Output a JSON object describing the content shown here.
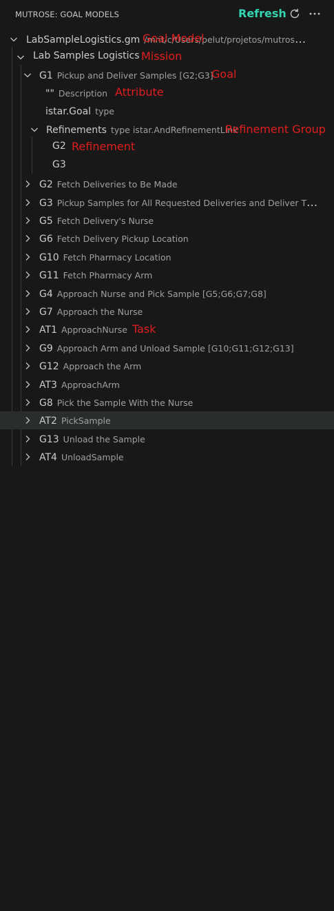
{
  "header": {
    "title": "MUTROSE: GOAL MODELS",
    "refresh_annotation": "Refresh",
    "refresh_icon": "refresh-icon",
    "more_icon": "ellipsis-icon"
  },
  "tree": {
    "root": {
      "label": "LabSampleLogistics.gm",
      "description": "/mnt/c/Users/pelut/projetos/mutrose-vs..."
    },
    "mission": {
      "label": "Lab Samples Logistics"
    },
    "g1": {
      "label": "G1",
      "description": "Pickup and Deliver Samples [G2;G3]"
    },
    "attribute": {
      "label": "\"\"",
      "description": "Description"
    },
    "type": {
      "label": "istar.Goal",
      "description": "type"
    },
    "refinements": {
      "label": "Refinements",
      "description": "type istar.AndRefinementLink"
    },
    "ref_g2": {
      "label": "G2"
    },
    "ref_g3": {
      "label": "G3"
    },
    "items": [
      {
        "label": "G2",
        "description": "Fetch Deliveries to Be Made"
      },
      {
        "label": "G3",
        "description": "Pickup Samples for All Requested Deliveries and Deliver The..."
      },
      {
        "label": "G5",
        "description": "Fetch Delivery's Nurse"
      },
      {
        "label": "G6",
        "description": "Fetch Delivery Pickup Location"
      },
      {
        "label": "G10",
        "description": "Fetch Pharmacy Location"
      },
      {
        "label": "G11",
        "description": "Fetch Pharmacy Arm"
      },
      {
        "label": "G4",
        "description": "Approach Nurse and Pick Sample [G5;G6;G7;G8]"
      },
      {
        "label": "G7",
        "description": "Approach the Nurse"
      },
      {
        "label": "AT1",
        "description": "ApproachNurse"
      },
      {
        "label": "G9",
        "description": "Approach Arm and Unload Sample [G10;G11;G12;G13]"
      },
      {
        "label": "G12",
        "description": "Approach the Arm"
      },
      {
        "label": "AT3",
        "description": "ApproachArm"
      },
      {
        "label": "G8",
        "description": "Pick the Sample With the Nurse"
      },
      {
        "label": "AT2",
        "description": "PickSample"
      },
      {
        "label": "G13",
        "description": "Unload the Sample"
      },
      {
        "label": "AT4",
        "description": "UnloadSample"
      }
    ]
  },
  "annotations": {
    "goal_model": "Goal Model",
    "mission": "Mission",
    "goal": "Goal",
    "attribute": "Attribute",
    "refinement_group": "Refinement Group",
    "refinement": "Refinement",
    "task": "Task"
  },
  "colors": {
    "background": "#181818",
    "annotation_red": "#e01e1e",
    "refresh_teal": "#33d6b0",
    "hover_row": "#2a2d2e"
  }
}
